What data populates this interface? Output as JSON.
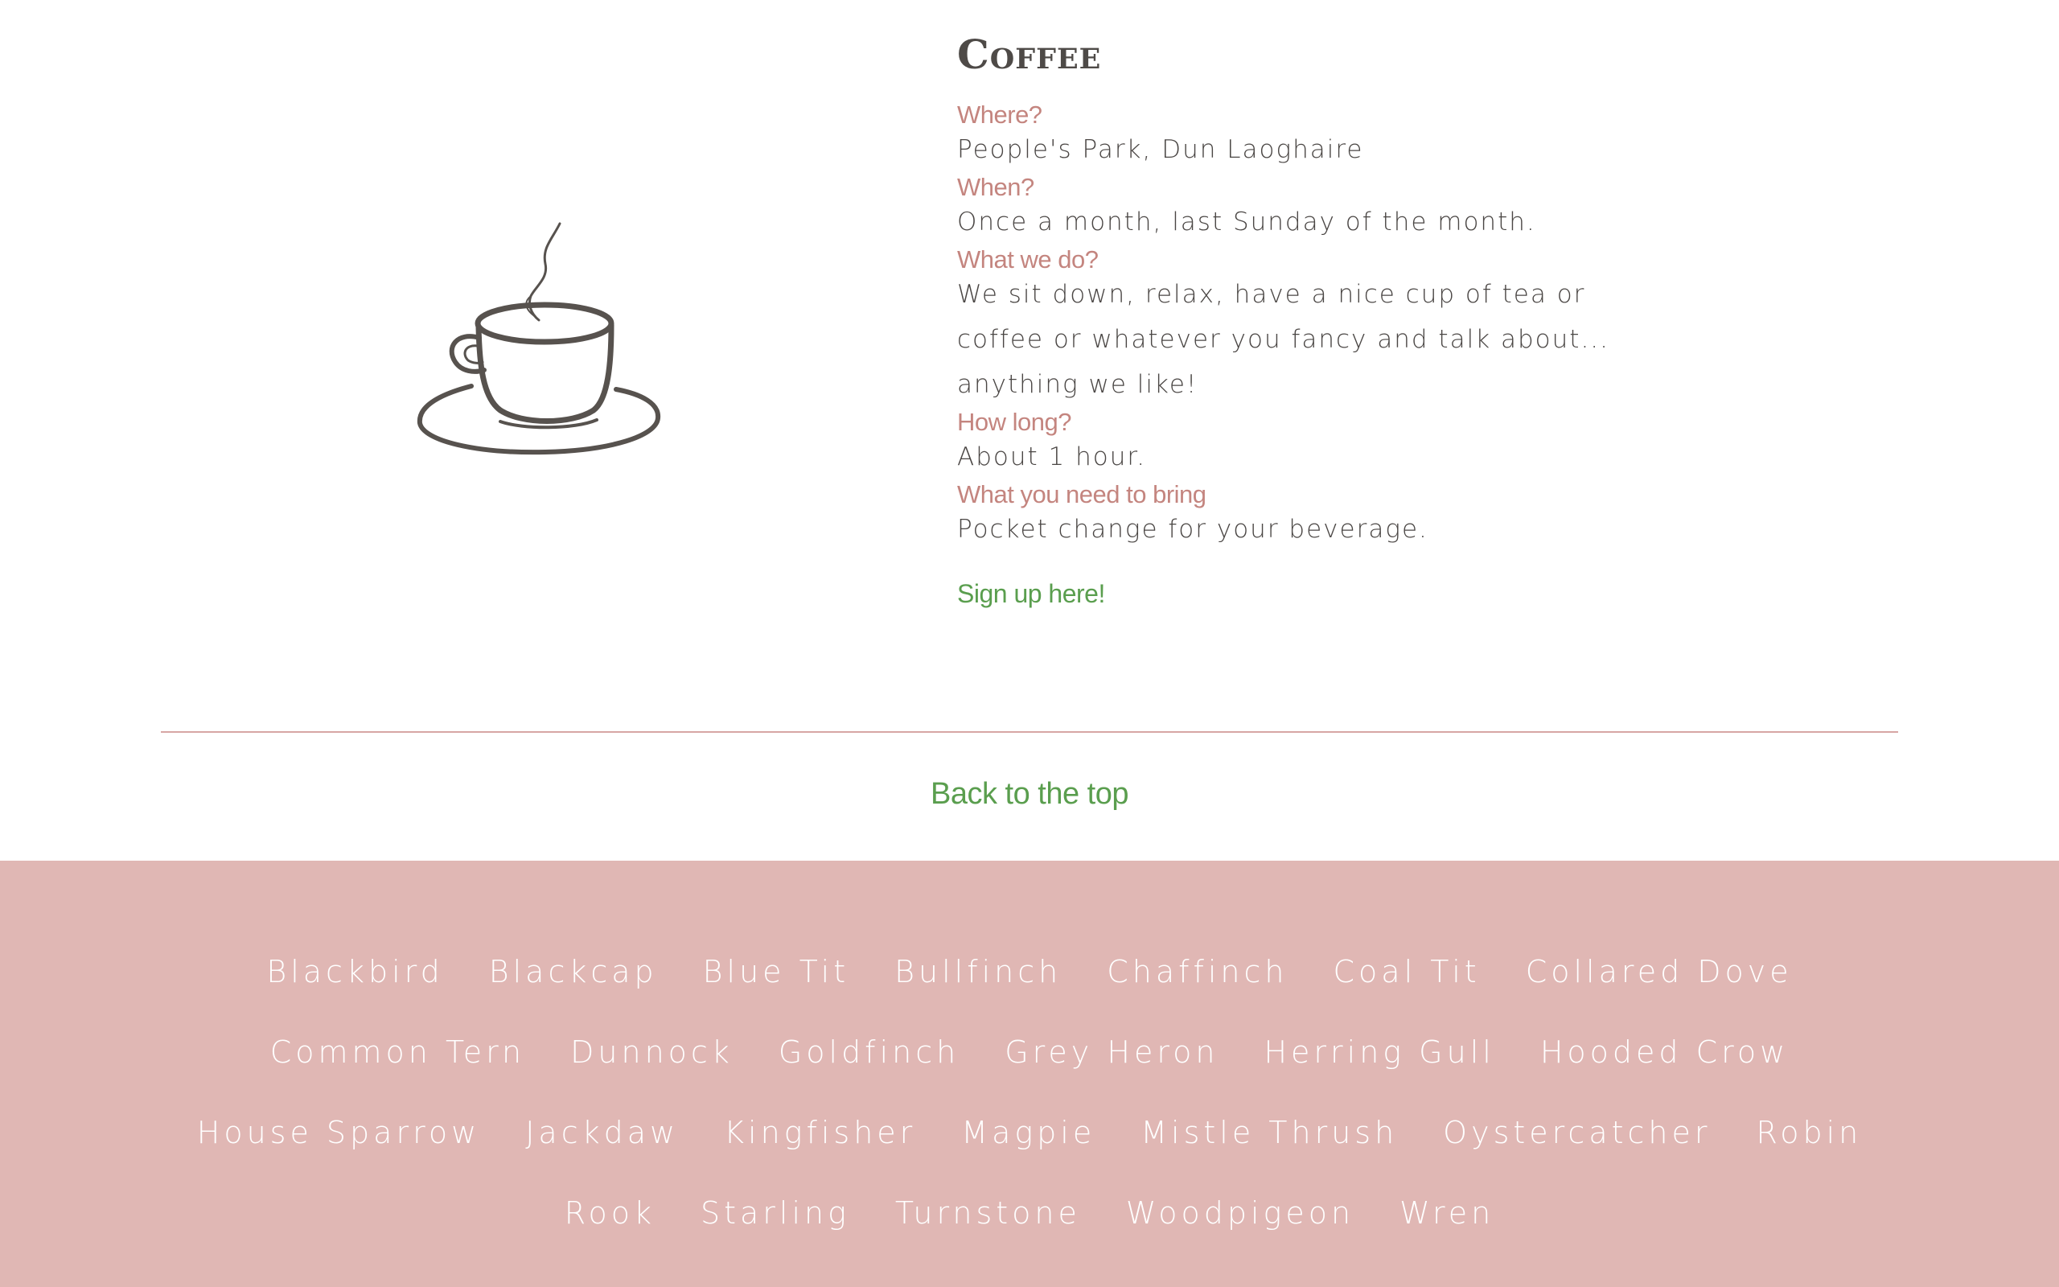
{
  "event": {
    "title": "Coffee",
    "items": [
      {
        "question": "Where?",
        "answer": "People's Park, Dun Laoghaire"
      },
      {
        "question": "When?",
        "answer": "Once a month, last Sunday of the month."
      },
      {
        "question": "What we do?",
        "answer": "We sit down, relax, have a nice cup of tea or coffee or whatever you fancy and talk about... anything we like!"
      },
      {
        "question": "How long?",
        "answer": "About 1 hour."
      },
      {
        "question": "What you need to bring",
        "answer": "Pocket change for your beverage."
      }
    ],
    "signup_label": "Sign up here!",
    "icon": "coffee-cup-icon"
  },
  "back_to_top": "Back to the top",
  "footer": {
    "birds": [
      "Blackbird",
      "Blackcap",
      "Blue Tit",
      "Bullfinch",
      "Chaffinch",
      "Coal Tit",
      "Collared Dove",
      "Common Tern",
      "Dunnock",
      "Goldfinch",
      "Grey Heron",
      "Herring Gull",
      "Hooded Crow",
      "House Sparrow",
      "Jackdaw",
      "Kingfisher",
      "Magpie",
      "Mistle Thrush",
      "Oystercatcher",
      "Robin",
      "Rook",
      "Starling",
      "Turnstone",
      "Woodpigeon",
      "Wren"
    ]
  },
  "colors": {
    "heading": "#4e4a47",
    "question": "#c4857f",
    "link": "#5a9e4e",
    "divider": "#d7a6a4",
    "footer_bg": "#e0b7b4"
  }
}
